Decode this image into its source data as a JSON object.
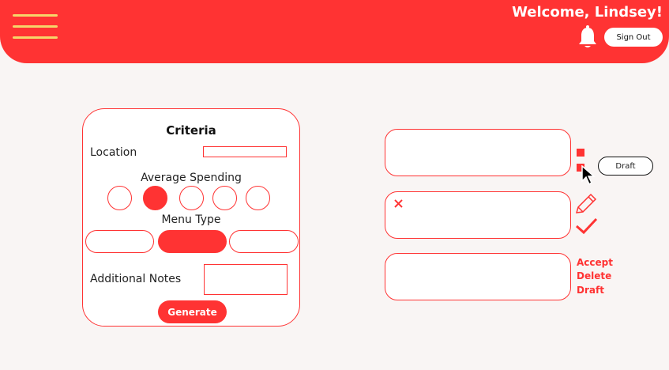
{
  "header": {
    "welcome": "Welcome, Lindsey!",
    "signout_label": "Sign Out"
  },
  "criteria": {
    "title": "Criteria",
    "location_label": "Location",
    "location_value": "",
    "spending_label": "Average Spending",
    "spending_selected_index": 1,
    "menu_type_label": "Menu Type",
    "menu_type_selected_index": 1,
    "notes_label": "Additional Notes",
    "notes_value": "",
    "generate_label": "Generate"
  },
  "results": {
    "draft_label": "Draft",
    "actions": {
      "accept": "Accept",
      "delete": "Delete",
      "draft": "Draft"
    }
  },
  "colors": {
    "accent": "#ff3333",
    "menu_lines": "#f6d56a",
    "background": "#f9f5f4"
  }
}
